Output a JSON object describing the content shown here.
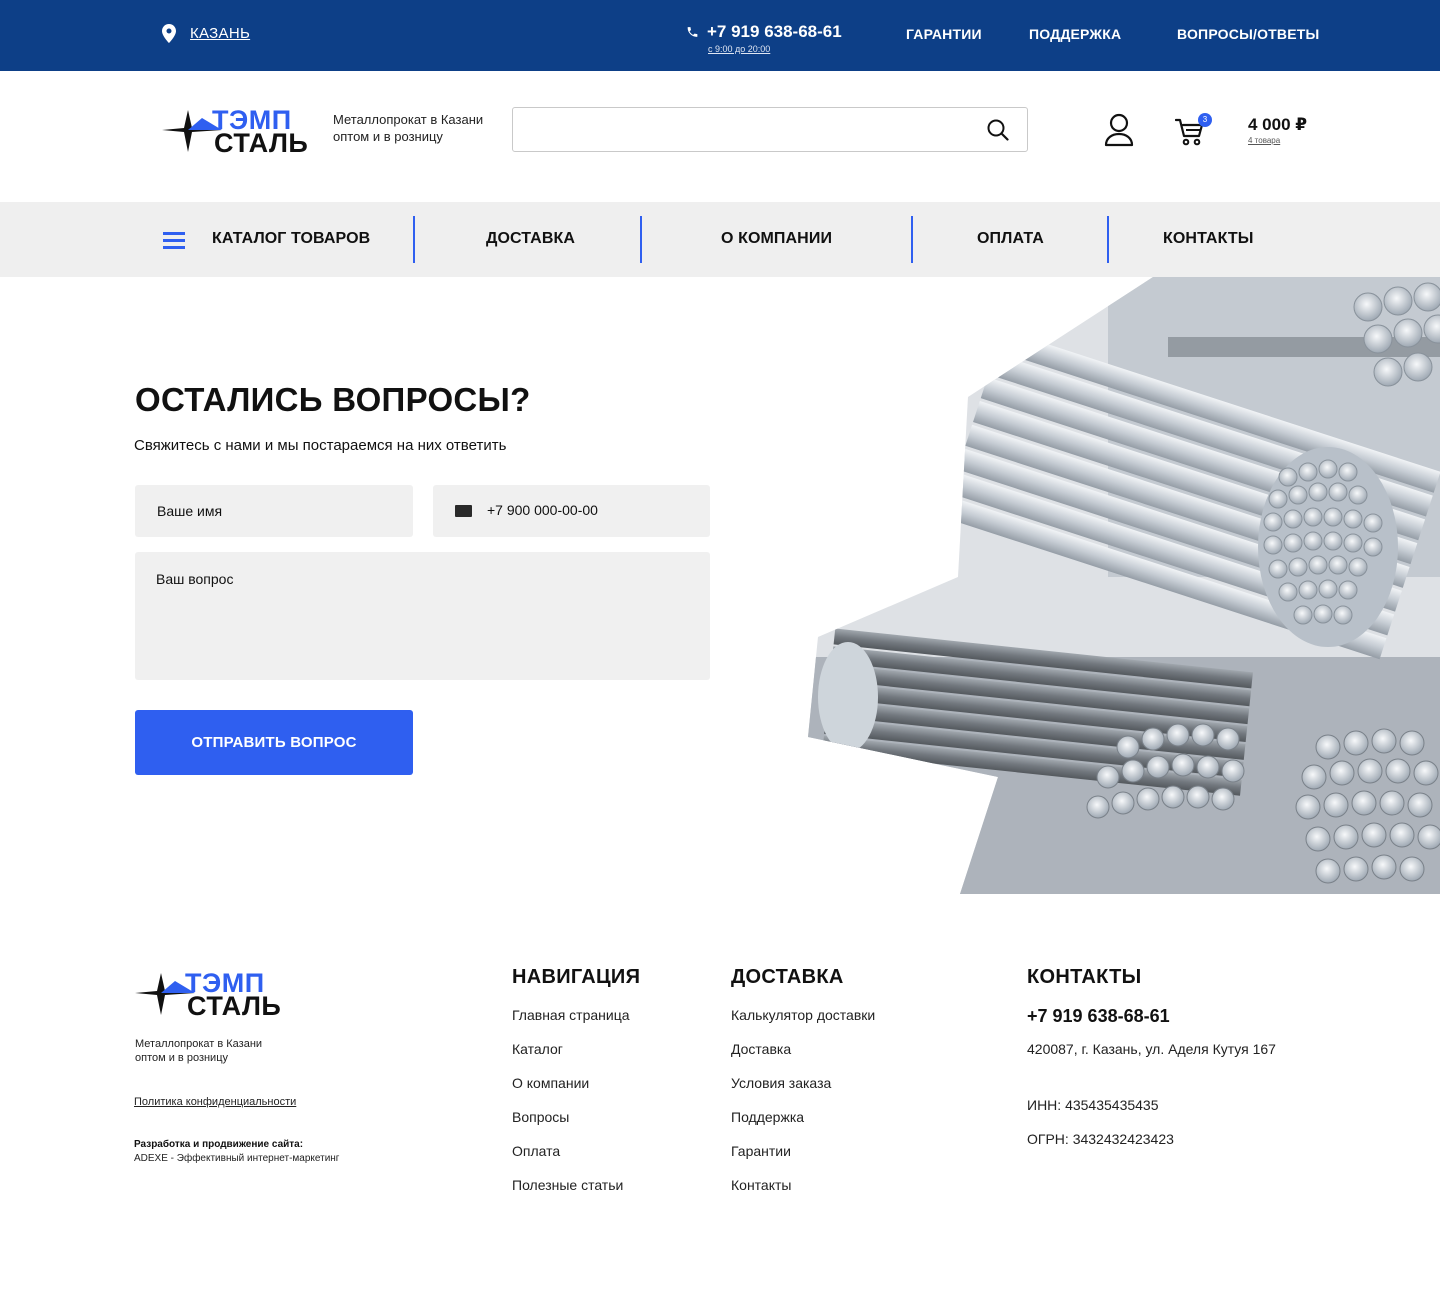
{
  "topbar": {
    "city": "КАЗАНЬ",
    "phone": "+7 919 638-68-61",
    "hours": "с 9:00 до 20:00",
    "links": [
      "ГАРАНТИИ",
      "ПОДДЕРЖКА",
      "ВОПРОСЫ/ОТВЕТЫ"
    ]
  },
  "brand": {
    "line1": "ТЭМП",
    "line2": "СТАЛЬ",
    "tagline1": "Металлопрокат в Казани",
    "tagline2": "оптом и в розницу"
  },
  "search": {
    "placeholder": ""
  },
  "cart": {
    "badge": "3",
    "total": "4 000 ₽",
    "count": "4 товара"
  },
  "nav": {
    "catalog": "КАТАЛОГ ТОВАРОВ",
    "delivery": "ДОСТАВКА",
    "about": "О КОМПАНИИ",
    "payment": "ОПЛАТА",
    "contacts": "КОНТАКТЫ"
  },
  "hero": {
    "title": "ОСТАЛИСЬ ВОПРОСЫ?",
    "subtitle": "Свяжитесь с нами и мы постараемся на них ответить",
    "name_placeholder": "Ваше имя",
    "phone_placeholder": "+7 900 000-00-00",
    "question_placeholder": "Ваш вопрос",
    "submit": "ОТПРАВИТЬ ВОПРОС"
  },
  "footer": {
    "policy": "Политика конфиденциальности",
    "dev_title": "Разработка и продвижение сайта:",
    "dev_value": "ADEXE - Эффективный интернет-маркетинг",
    "nav_title": "НАВИГАЦИЯ",
    "nav_links": [
      "Главная страница",
      "Каталог",
      "О компании",
      "Вопросы",
      "Оплата",
      "Полезные статьи"
    ],
    "delivery_title": "ДОСТАВКА",
    "delivery_links": [
      "Калькулятор доставки",
      "Доставка",
      "Условия заказа",
      "Поддержка",
      "Гарантии",
      "Контакты"
    ],
    "contacts_title": "КОНТАКТЫ",
    "phone": "+7 919 638-68-61",
    "address": "420087,  г. Казань, ул. Аделя Кутуя 167",
    "inn": "ИНН: 435435435435",
    "ogrn": "ОГРН: 3432432423423"
  },
  "colors": {
    "topbar": "#0d3f87",
    "accent": "#2f5ff0",
    "navbar_bg": "#efefef",
    "field_bg": "#f0f0f0"
  }
}
